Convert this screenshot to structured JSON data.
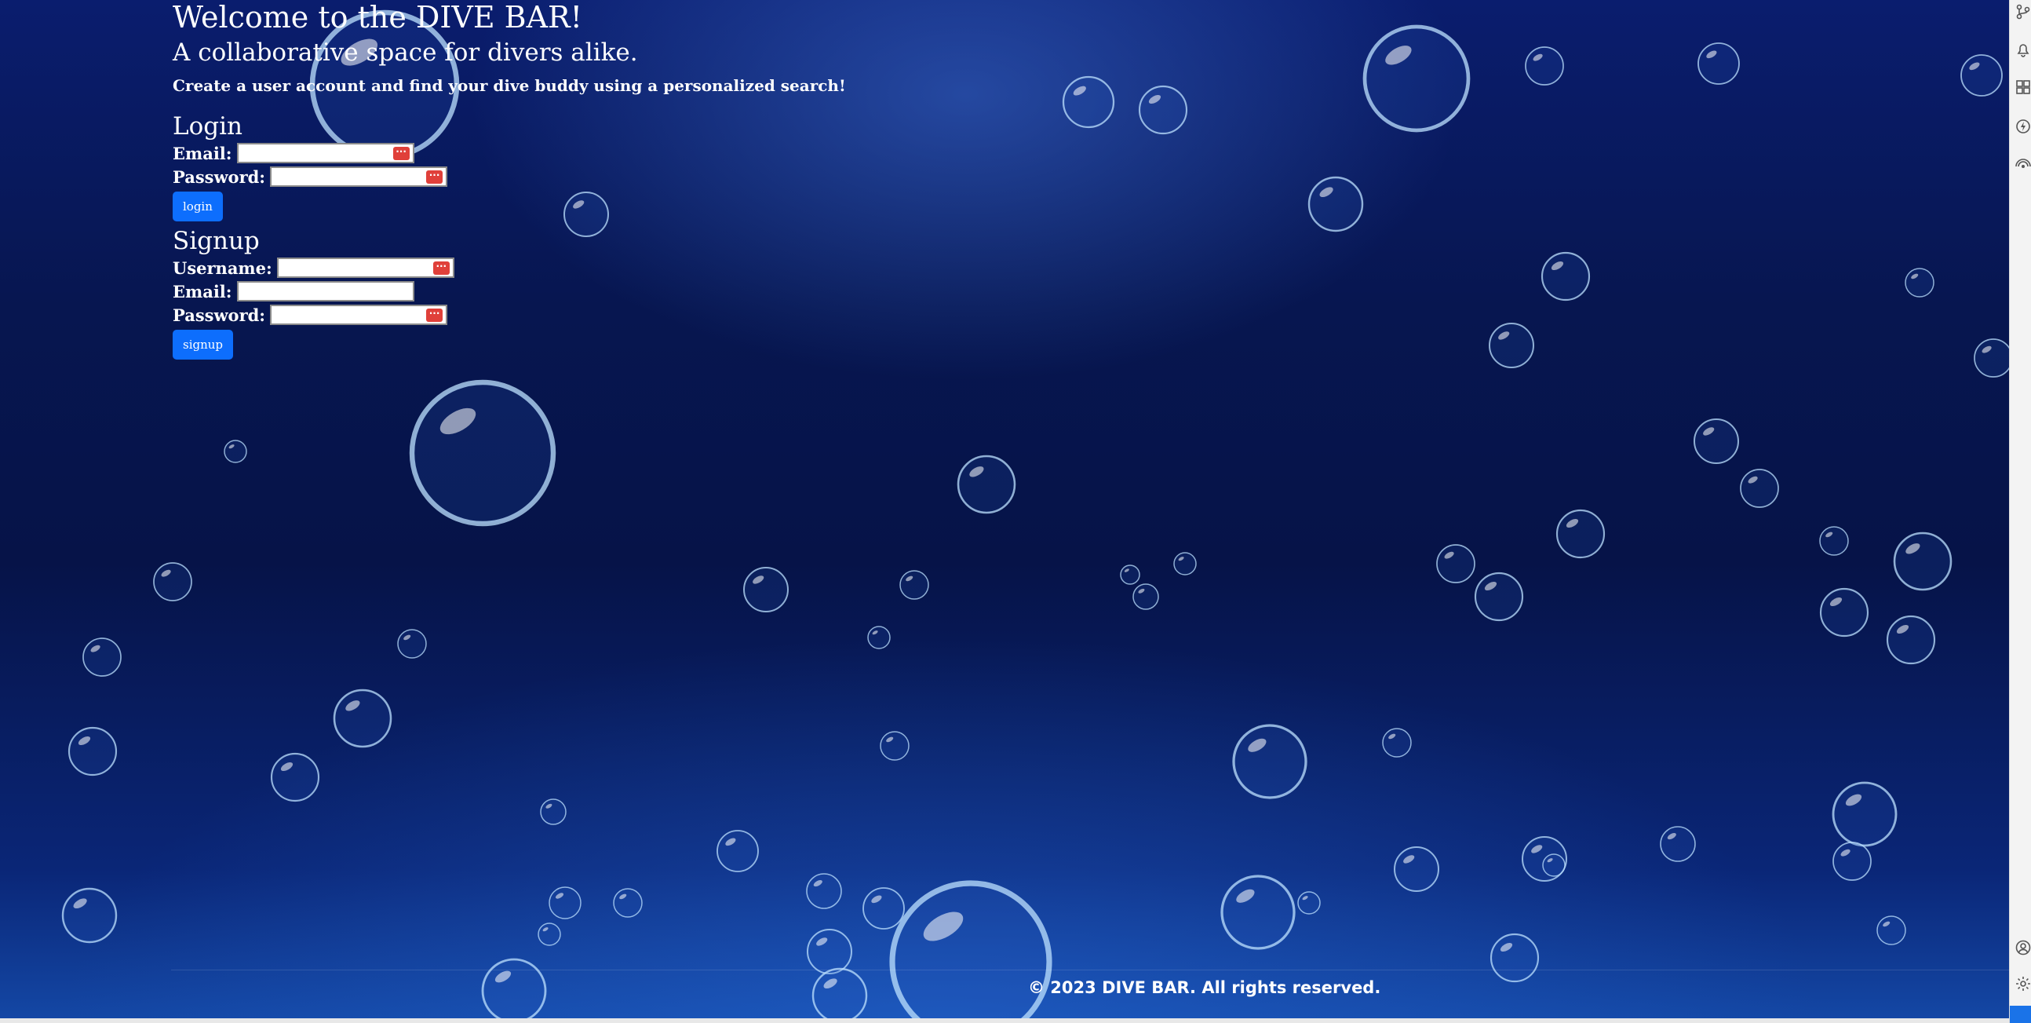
{
  "header": {
    "title": "Welcome to the DIVE BAR!",
    "subtitle": "A collaborative space for divers alike.",
    "intro": "Create a user account and find your dive buddy using a personalized search!"
  },
  "login": {
    "heading": "Login",
    "email_label": "Email:",
    "email_value": "",
    "password_label": "Password:",
    "password_value": "",
    "button_label": "login",
    "password_manager_icon": "more-dots-icon"
  },
  "signup": {
    "heading": "Signup",
    "username_label": "Username:",
    "username_value": "",
    "email_label": "Email:",
    "email_value": "",
    "password_label": "Password:",
    "password_value": "",
    "button_label": "signup",
    "password_manager_icon": "more-dots-icon"
  },
  "footer": {
    "text": "© 2023 DIVE BAR. All rights reserved."
  },
  "side_dock": {
    "top_icons": [
      "branch-icon",
      "bell-icon",
      "grid-icon",
      "lightning-icon",
      "broadcast-icon"
    ],
    "bottom_icons": [
      "account-icon",
      "settings-icon"
    ]
  },
  "colors": {
    "button": "#0d6efd",
    "password_manager_icon": "#e0403a",
    "background_deep": "#061348",
    "background_light": "#1448a6"
  }
}
